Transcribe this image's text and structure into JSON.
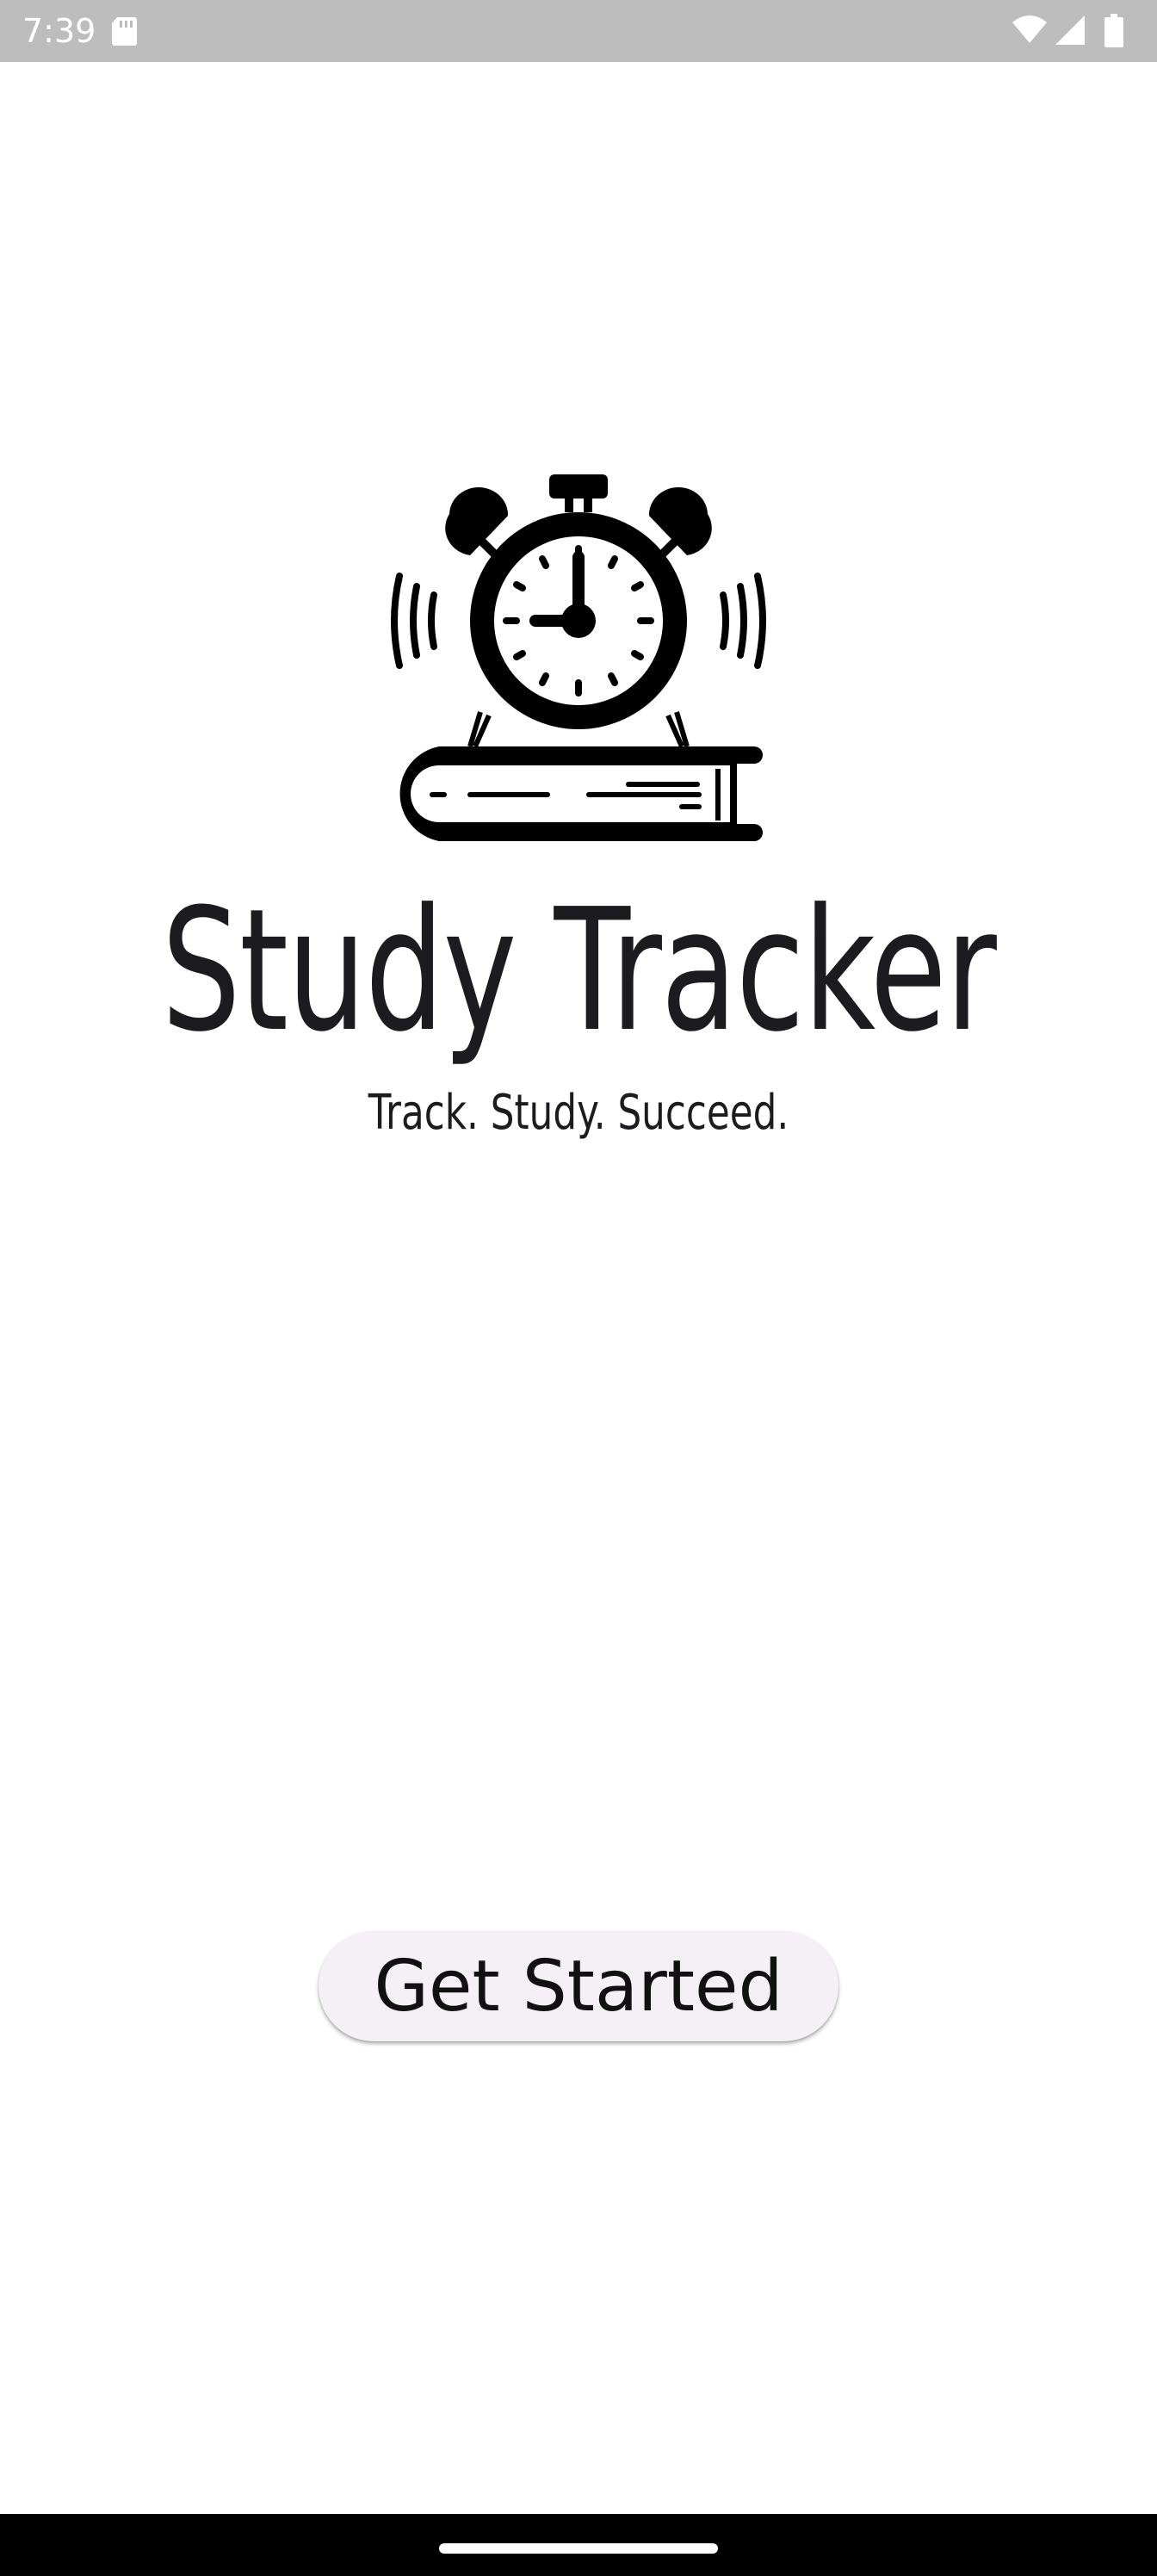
{
  "status_bar": {
    "time": "7:39",
    "icons": [
      "sd-card-icon",
      "wifi-icon",
      "signal-icon",
      "battery-icon"
    ]
  },
  "logo": {
    "icon": "alarm-clock-on-book-icon"
  },
  "main": {
    "title": "Study Tracker",
    "tagline": "Track. Study. Succeed."
  },
  "actions": {
    "get_started_label": "Get Started"
  },
  "colors": {
    "status_bar": "#bdbdbd",
    "button_bg": "#f5eff6",
    "text": "#1c1b1f",
    "nav_bar": "#000000"
  }
}
